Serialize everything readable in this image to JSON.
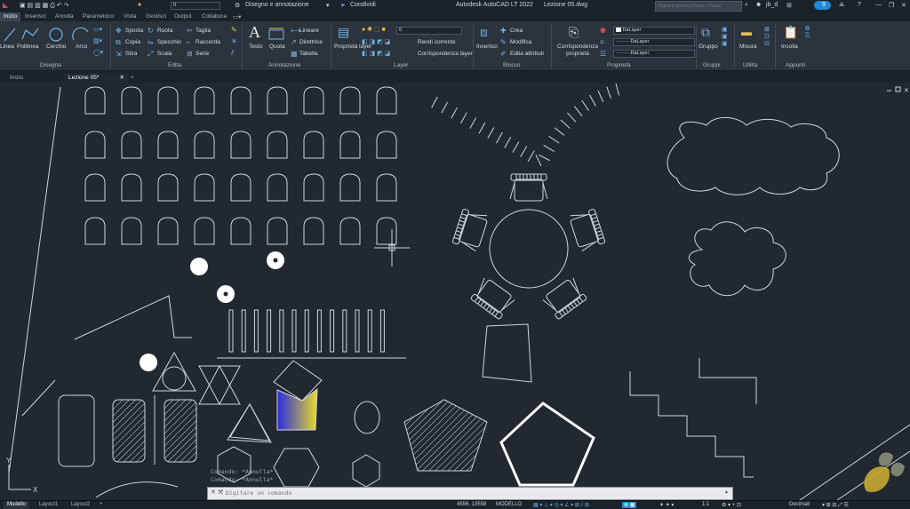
{
  "title_bar": {
    "app_title": "Autodesk AutoCAD LT 2022",
    "file_name": "Lezione 05.dwg",
    "layer_value": "0",
    "workspace": "Disegno e annotazione",
    "share_label": "Condividi",
    "search_placeholder": "Digitare parola chiave o frase",
    "user": "jb_d",
    "notif_count": "9"
  },
  "ribbon_tabs": [
    "Inizio",
    "Inserisci",
    "Annota",
    "Parametrico",
    "Vista",
    "Gestisci",
    "Output",
    "Collabora"
  ],
  "ribbon": {
    "draw": {
      "linea": "Linea",
      "polilinea": "Polilinea",
      "cerchio": "Cerchio",
      "arco": "Arco",
      "group": "Disegna"
    },
    "modify": {
      "sposta": "Sposta",
      "ruota": "Ruota",
      "taglia": "Taglia",
      "copia": "Copia",
      "specchio": "Specchio",
      "raccorda": "Raccorda",
      "stira": "Stira",
      "scala": "Scala",
      "serie": "Serie",
      "group": "Edita"
    },
    "annotation": {
      "testo": "Testo",
      "quota": "Quota",
      "lineare": "Lineare",
      "direttrice": "Direttrice",
      "tabella": "Tabella",
      "group": "Annotazione"
    },
    "layers": {
      "proprieta_layer": "Proprietà layer",
      "layer_value": "0",
      "rendi_corrente": "Rendi corrente",
      "corrispondenza_layer": "Corrispondenza layer",
      "group": "Layer"
    },
    "block": {
      "inserisci": "Inserisci",
      "crea": "Crea",
      "modifica": "Modifica",
      "edita_attributi": "Edita attributi",
      "group": "Blocco"
    },
    "properties": {
      "corrispondenza": "Corrispondenza proprietà",
      "color": "DaLayer",
      "linetype": "DaLayer",
      "lineweight": "DaLayer",
      "group": "Proprietà"
    },
    "groups": {
      "gruppo": "Gruppo",
      "group": "Gruppi"
    },
    "utilities": {
      "misura": "Misura",
      "group": "Utilità"
    },
    "clipboard": {
      "incolla": "Incolla",
      "group": "Appunti"
    }
  },
  "doc_tabs": [
    "Inizio",
    "Lezione 05*"
  ],
  "command": {
    "history": [
      "Comando: *Annulla*",
      "Comando: *Annulla*"
    ],
    "placeholder": "Digitare un comando"
  },
  "status": {
    "tabs": [
      "Modello",
      "Layout1",
      "Layout2"
    ],
    "coords": "4556, 13558",
    "mode": "MODELLO",
    "scale": "1:1",
    "annotation_scale": "Decimali"
  },
  "colors": {
    "accent": "#1f8ad8",
    "canvas": "#212830",
    "hatch_yellow": "#e8dc2a",
    "hatch_blue": "#2a2ae0"
  }
}
